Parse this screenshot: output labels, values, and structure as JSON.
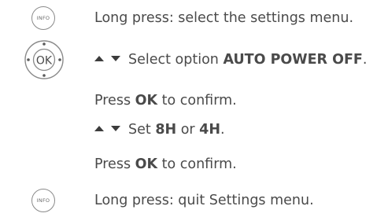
{
  "steps": {
    "step1": {
      "icon": "info-button-icon",
      "icon_label": "INFO",
      "text": "Long press: select the settings menu."
    },
    "step2": {
      "icon": "ok-navigation-pad-icon",
      "icon_label": "OK",
      "prefix": "Select option ",
      "bold": "AUTO POWER OFF",
      "suffix": "."
    },
    "step3": {
      "prefix": "Press ",
      "bold": "OK",
      "suffix": " to confirm."
    },
    "step4": {
      "prefix": "Set ",
      "bold1": "8H",
      "middle": " or ",
      "bold2": "4H",
      "suffix": "."
    },
    "step5": {
      "prefix": "Press ",
      "bold": "OK",
      "suffix": " to confirm."
    },
    "step6": {
      "icon": "info-button-icon",
      "icon_label": "INFO",
      "text": "Long press: quit Settings menu."
    }
  },
  "colors": {
    "text": "#4a4a4a",
    "icon_stroke": "#8a8a8a",
    "arrow": "#3c3c3c"
  }
}
